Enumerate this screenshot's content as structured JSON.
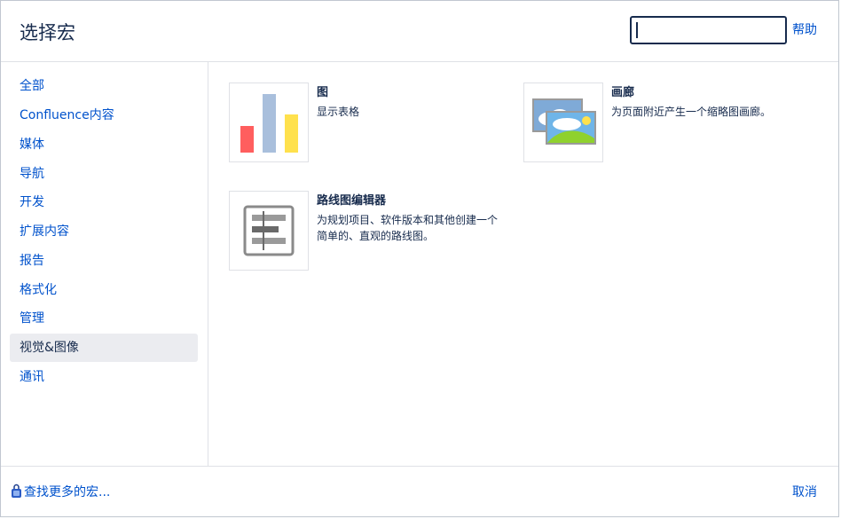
{
  "header": {
    "title": "选择宏",
    "search_value": "",
    "help_label": "帮助"
  },
  "sidebar": {
    "items": [
      {
        "label": "全部",
        "selected": false
      },
      {
        "label": "Confluence内容",
        "selected": false
      },
      {
        "label": "媒体",
        "selected": false
      },
      {
        "label": "导航",
        "selected": false
      },
      {
        "label": "开发",
        "selected": false
      },
      {
        "label": "扩展内容",
        "selected": false
      },
      {
        "label": "报告",
        "selected": false
      },
      {
        "label": "格式化",
        "selected": false
      },
      {
        "label": "管理",
        "selected": false
      },
      {
        "label": "视觉&图像",
        "selected": true
      },
      {
        "label": "通讯",
        "selected": false
      }
    ]
  },
  "macros": [
    {
      "name": "图",
      "description": "显示表格",
      "icon": "bar-chart-icon"
    },
    {
      "name": "画廊",
      "description": "为页面附近产生一个缩略图画廊。",
      "icon": "gallery-icon"
    },
    {
      "name": "路线图编辑器",
      "description": "为规划项目、软件版本和其他创建一个简单的、直观的路线图。",
      "icon": "roadmap-icon"
    }
  ],
  "footer": {
    "more_label": "查找更多的宏...",
    "more_icon": "marketplace-bag-icon",
    "cancel_label": "取消"
  },
  "colors": {
    "link": "#0052cc",
    "text": "#172b4d",
    "selected_bg": "#ebecf0",
    "bar_red": "#ff5e5e",
    "bar_blue": "#a9bfdc",
    "bar_yellow": "#ffe14d"
  }
}
